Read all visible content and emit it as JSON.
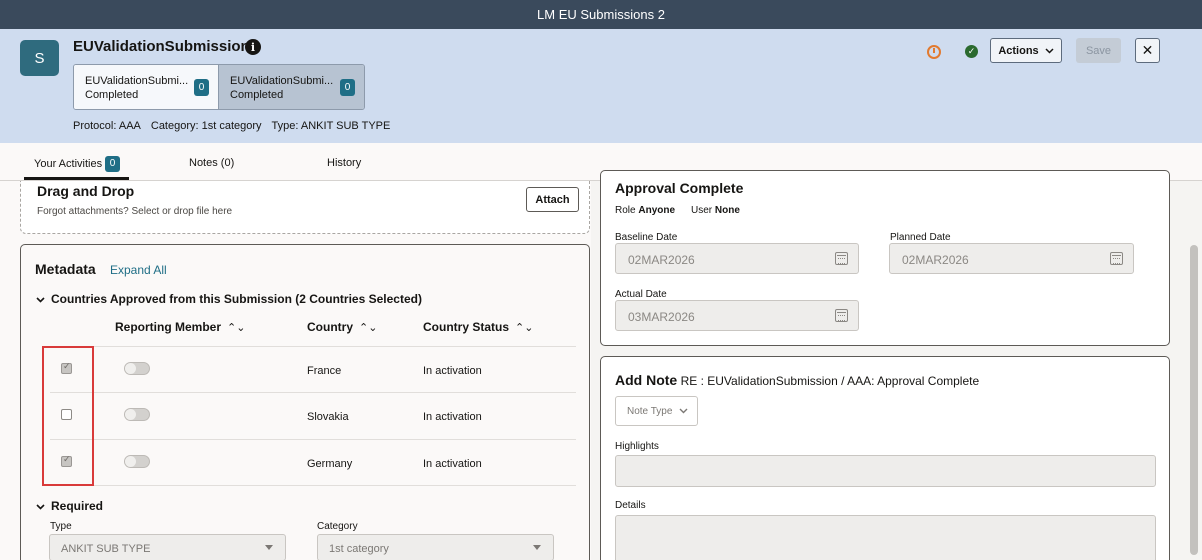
{
  "window": {
    "title": "LM EU Submissions 2"
  },
  "header": {
    "avatar_letter": "S",
    "title": "EUValidationSubmission",
    "info_glyph": "i",
    "cards": [
      {
        "title": "EUValidationSubmi...",
        "status": "Completed",
        "count": "0"
      },
      {
        "title": "EUValidationSubmi...",
        "status": "Completed",
        "count": "0"
      }
    ],
    "protocol": "Protocol: AAA",
    "category": "Category: 1st category",
    "type": "Type: ANKIT SUB TYPE",
    "actions_label": "Actions",
    "save_label": "Save",
    "close_glyph": "✕",
    "colors": {
      "clock": "#e27a2f",
      "check": "#2b6a2f",
      "accent": "#1f6e86"
    }
  },
  "tabs": {
    "activities": "Your Activities",
    "activities_count": "0",
    "notes": "Notes (0)",
    "history": "History"
  },
  "dropzone": {
    "title": "Drag and Drop",
    "subtitle": "Forgot attachments? Select or drop file here",
    "attach_label": "Attach"
  },
  "metadata": {
    "title": "Metadata",
    "expand_all": "Expand All",
    "countries_section": "Countries Approved from this Submission (2 Countries Selected)",
    "columns": [
      "Reporting Member",
      "Country",
      "Country Status"
    ],
    "rows": [
      {
        "checked": true,
        "reporting_member": false,
        "country": "France",
        "status": "In activation"
      },
      {
        "checked": false,
        "reporting_member": false,
        "country": "Slovakia",
        "status": "In activation"
      },
      {
        "checked": true,
        "reporting_member": false,
        "country": "Germany",
        "status": "In activation"
      }
    ],
    "required_section": "Required",
    "type_label": "Type",
    "type_value": "ANKIT SUB TYPE",
    "category_label": "Category",
    "category_value": "1st category"
  },
  "approval": {
    "title": "Approval Complete",
    "role_label": "Role",
    "role_value": "Anyone",
    "user_label": "User",
    "user_value": "None",
    "baseline_label": "Baseline Date",
    "baseline_value": "02MAR2026",
    "planned_label": "Planned Date",
    "planned_value": "02MAR2026",
    "actual_label": "Actual Date",
    "actual_value": "03MAR2026"
  },
  "add_note": {
    "title": "Add Note",
    "subtitle": "RE : EUValidationSubmission / AAA: Approval Complete",
    "note_type_placeholder": "Note Type",
    "highlights_label": "Highlights",
    "details_label": "Details"
  }
}
